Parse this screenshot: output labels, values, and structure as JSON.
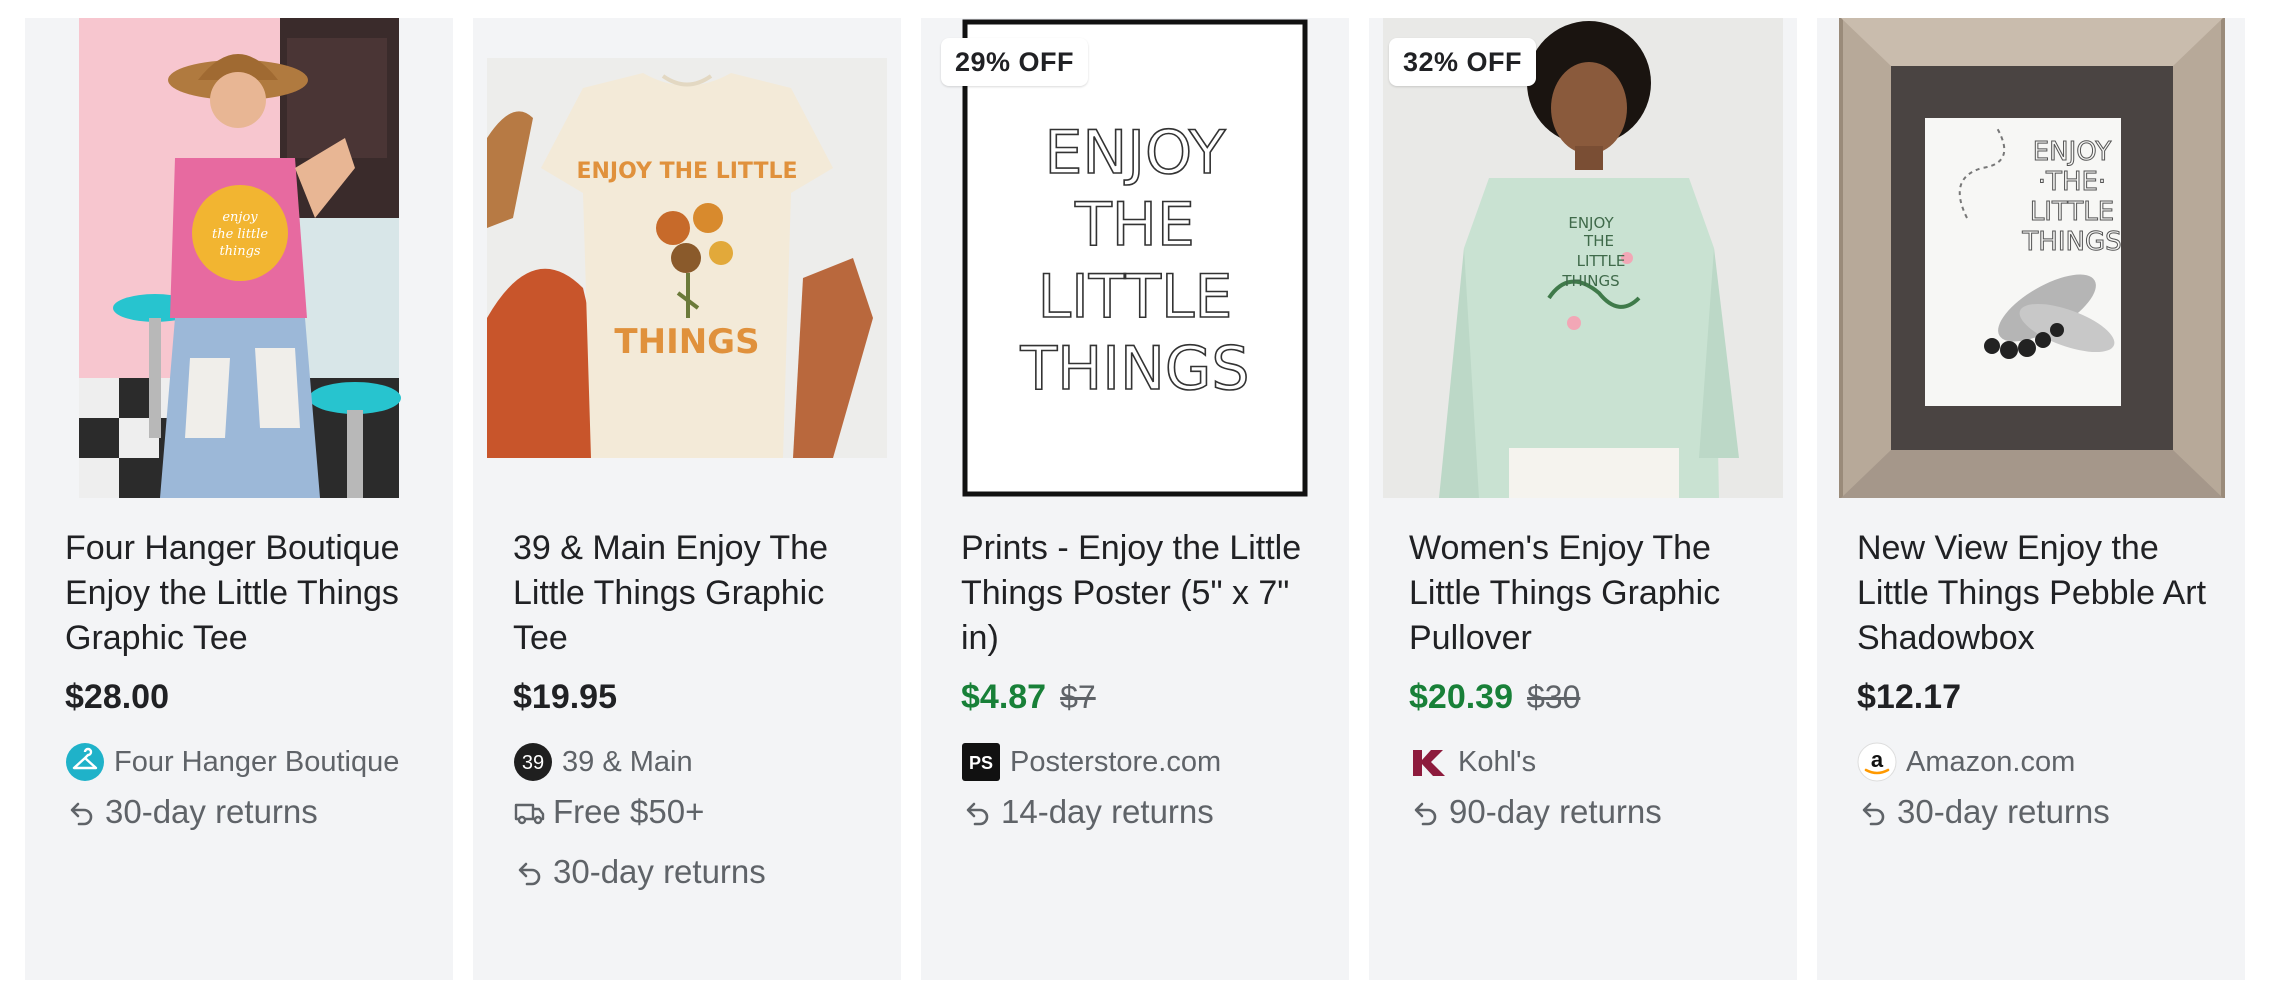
{
  "products": [
    {
      "badge": "",
      "title": "Four Hanger Boutique Enjoy the Little Things Graphic Tee",
      "price": "$28.00",
      "old_price": "",
      "seller": "Four Hanger Boutique",
      "seller_icon": "hanger-logo-icon",
      "info": [
        {
          "icon": "return-arrow-icon",
          "text": "30-day returns"
        }
      ]
    },
    {
      "badge": "",
      "title": "39 & Main Enjoy The Little Things Graphic Tee",
      "price": "$19.95",
      "old_price": "",
      "seller": "39 & Main",
      "seller_icon_text": "39",
      "info": [
        {
          "icon": "delivery-truck-icon",
          "text": "Free $50+"
        },
        {
          "icon": "return-arrow-icon",
          "text": "30-day returns"
        }
      ]
    },
    {
      "badge": "29% OFF",
      "title": "Prints - Enjoy the Little Things Poster (5\" x 7\" in)",
      "price": "$4.87",
      "old_price": "$7",
      "seller": "Posterstore.com",
      "seller_icon_text": "PS",
      "info": [
        {
          "icon": "return-arrow-icon",
          "text": "14-day returns"
        }
      ]
    },
    {
      "badge": "32% OFF",
      "title": "Women's Enjoy The Little Things Graphic Pullover",
      "price": "$20.39",
      "old_price": "$30",
      "seller": "Kohl's",
      "seller_icon": "kohls-k-logo-icon",
      "info": [
        {
          "icon": "return-arrow-icon",
          "text": "90-day returns"
        }
      ]
    },
    {
      "badge": "",
      "title": "New View Enjoy the Little Things Pebble Art Shadowbox",
      "price": "$12.17",
      "old_price": "",
      "seller": "Amazon.com",
      "seller_icon_text": "a",
      "info": [
        {
          "icon": "return-arrow-icon",
          "text": "30-day returns"
        }
      ]
    }
  ],
  "artwork_text": {
    "poster_lines": [
      "ENJOY",
      "THE",
      "LITTLE",
      "THINGS"
    ],
    "shirt1_lines": [
      "enjoy",
      "the little",
      "things"
    ],
    "shirt2_top": "ENJOY THE LITTLE",
    "shirt2_bottom": "THINGS",
    "pullover_lines": [
      "ENJOY",
      "THE",
      "LITTLE",
      "THINGS"
    ],
    "shadowbox_lines": [
      "ENJOY",
      "·THE·",
      "LITTLE",
      "THINGS"
    ]
  },
  "colors": {
    "card_bg": "#f3f4f6",
    "sale_price": "#188038",
    "muted_text": "#5f6368",
    "primary_text": "#202124"
  }
}
